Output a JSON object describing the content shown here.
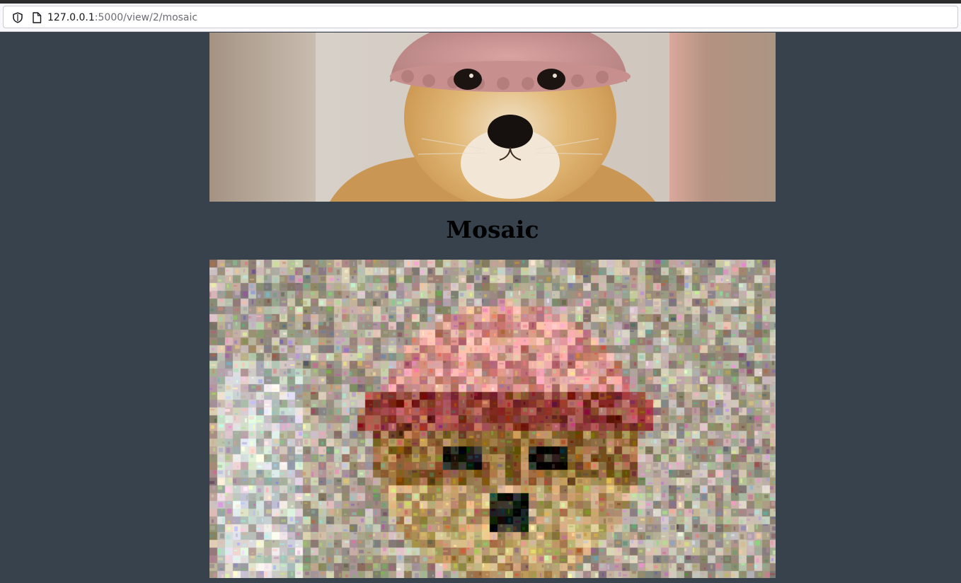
{
  "browser": {
    "url_host": "127.0.0.1",
    "url_rest": ":5000/view/2/mosaic",
    "icons": [
      "shield-icon",
      "page-icon"
    ]
  },
  "page": {
    "heading": "Mosaic",
    "background_color": "#37424d"
  },
  "images": {
    "source_photo": "Shiba Inu dog wearing a pink knitted hat",
    "mosaic": "Photo mosaic of the dog built from small animal thumbnail tiles"
  }
}
